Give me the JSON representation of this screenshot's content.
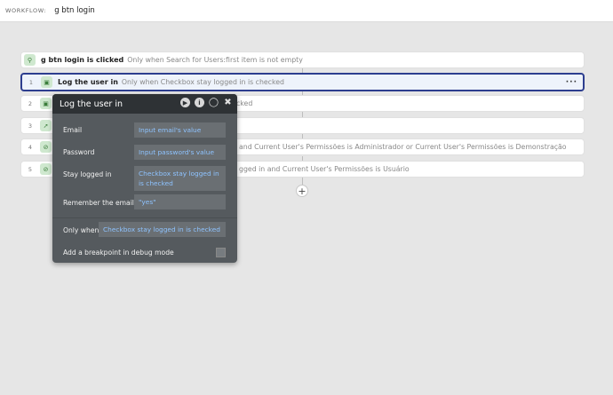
{
  "workflow": {
    "label": "WORKFLOW:",
    "name": "g btn login"
  },
  "trigger": {
    "title": "g btn login is clicked",
    "condition": "Only when Search for Users:first item is not empty"
  },
  "steps": [
    {
      "num": "1",
      "title": "Log the user in",
      "condition": "Only when Checkbox stay logged in is checked",
      "more": "···"
    },
    {
      "num": "2",
      "tail": "cked"
    },
    {
      "num": "3",
      "tail": ""
    },
    {
      "num": "4",
      "tail": "and Current User's Permissões is Administrador or Current User's Permissões is Demonstração"
    },
    {
      "num": "5",
      "tail": "gged in and Current User's Permissões is Usuário"
    }
  ],
  "add_label": "+",
  "panel": {
    "title": "Log the user in",
    "icons": [
      "play-icon",
      "info-icon",
      "comment-icon",
      "close-icon"
    ],
    "fields": {
      "email": {
        "label": "Email",
        "value": "Input email's value"
      },
      "password": {
        "label": "Password",
        "value": "Input password's value"
      },
      "stay": {
        "label": "Stay logged in",
        "value": "Checkbox stay logged in is checked"
      },
      "remember": {
        "label": "Remember the email",
        "value": "\"yes\""
      },
      "only_when": {
        "label": "Only when",
        "value": "Checkbox stay logged in is checked"
      },
      "breakpoint": {
        "label": "Add a breakpoint in debug mode"
      }
    }
  }
}
